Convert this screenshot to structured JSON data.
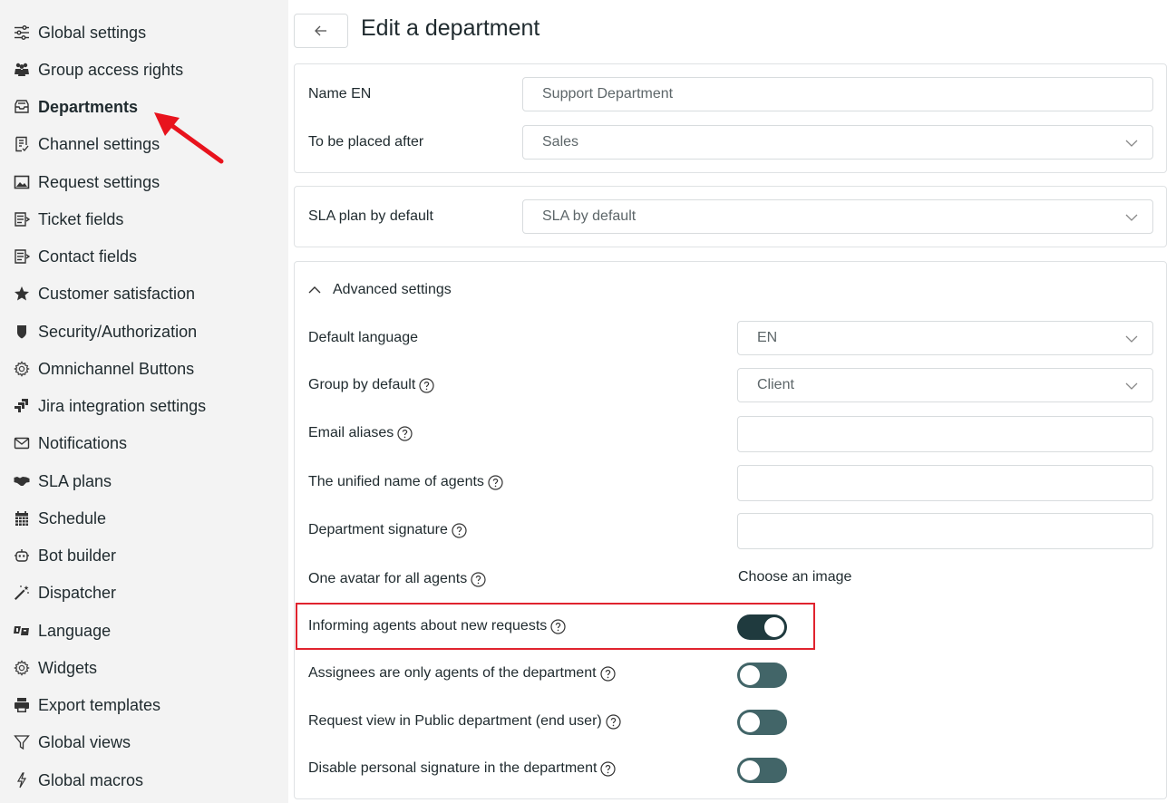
{
  "sidebar": {
    "items": [
      {
        "label": "Global settings",
        "icon": "sliders-icon"
      },
      {
        "label": "Group access rights",
        "icon": "people-icon"
      },
      {
        "label": "Departments",
        "icon": "inbox-icon",
        "active": true
      },
      {
        "label": "Channel settings",
        "icon": "document-list-icon"
      },
      {
        "label": "Request settings",
        "icon": "image-icon"
      },
      {
        "label": "Ticket fields",
        "icon": "form-icon"
      },
      {
        "label": "Contact fields",
        "icon": "form-icon"
      },
      {
        "label": "Customer satisfaction",
        "icon": "star-icon"
      },
      {
        "label": "Security/Authorization",
        "icon": "shield-icon"
      },
      {
        "label": "Omnichannel Buttons",
        "icon": "gear-icon"
      },
      {
        "label": "Jira integration settings",
        "icon": "jira-icon"
      },
      {
        "label": "Notifications",
        "icon": "envelope-icon"
      },
      {
        "label": "SLA plans",
        "icon": "handshake-icon"
      },
      {
        "label": "Schedule",
        "icon": "calendar-icon"
      },
      {
        "label": "Bot builder",
        "icon": "robot-icon"
      },
      {
        "label": "Dispatcher",
        "icon": "magic-wand-icon"
      },
      {
        "label": "Language",
        "icon": "translate-icon"
      },
      {
        "label": "Widgets",
        "icon": "gear-icon"
      },
      {
        "label": "Export templates",
        "icon": "printer-icon"
      },
      {
        "label": "Global views",
        "icon": "filter-icon"
      },
      {
        "label": "Global macros",
        "icon": "lightning-icon"
      }
    ]
  },
  "header": {
    "title": "Edit a department",
    "back_icon": "arrow-left-icon"
  },
  "card1": {
    "name_label": "Name EN",
    "name_value": "Support Department",
    "placed_after_label": "To be placed after",
    "placed_after_value": "Sales"
  },
  "card2": {
    "sla_label": "SLA plan by default",
    "sla_value": "SLA by default"
  },
  "advanced": {
    "toggle_label": "Advanced settings",
    "default_language_label": "Default language",
    "default_language_value": "EN",
    "group_default_label": "Group by default",
    "group_default_value": "Client",
    "email_aliases_label": "Email aliases",
    "email_aliases_value": "",
    "unified_name_label": "The unified name of agents",
    "unified_name_value": "",
    "signature_label": "Department signature",
    "signature_value": "",
    "avatar_label": "One avatar for all agents",
    "avatar_link": "Choose an image",
    "toggles": [
      {
        "label": "Informing agents about new requests",
        "on": true,
        "highlighted": true
      },
      {
        "label": "Assignees are only agents of the department",
        "on": false
      },
      {
        "label": "Request view in Public department (end user)",
        "on": false
      },
      {
        "label": "Disable personal signature in the department",
        "on": false
      }
    ]
  },
  "colors": {
    "sidebar_bg": "#f3f3f3",
    "toggle_on": "#1f3a3e",
    "toggle_off": "#426568",
    "highlight": "#e0232e",
    "annotation_arrow": "#e8131d"
  }
}
